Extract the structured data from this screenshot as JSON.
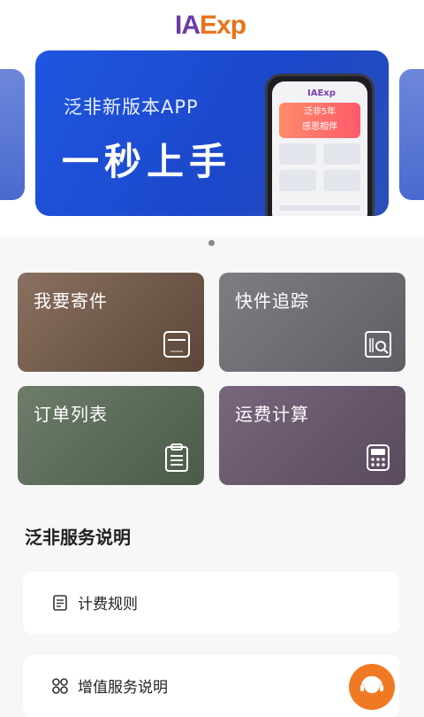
{
  "header": {
    "logo_part1": "IA",
    "logo_part2": "Exp"
  },
  "banner": {
    "subtitle": "泛非新版本APP",
    "headline": "一秒上手",
    "phone_logo": "IAExp",
    "phone_card_line1": "泛非5年",
    "phone_card_line2": "感恩相伴",
    "carousel_position": "1 of 1"
  },
  "shortcuts": [
    {
      "label": "我要寄件",
      "icon": "package-icon"
    },
    {
      "label": "快件追踪",
      "icon": "tracking-search-icon"
    },
    {
      "label": "订单列表",
      "icon": "clipboard-list-icon"
    },
    {
      "label": "运费计算",
      "icon": "calculator-icon"
    }
  ],
  "colors": {
    "brand_purple": "#6a3aa8",
    "brand_orange": "#e8731a",
    "banner_blue": "#1f56e0",
    "fab_orange": "#f07a24"
  },
  "services": {
    "title": "泛非服务说明",
    "items": [
      {
        "label": "计费规则",
        "icon": "document-icon"
      },
      {
        "label": "增值服务说明",
        "icon": "grid-icon"
      }
    ]
  },
  "fab": {
    "icon": "customer-service-icon"
  }
}
